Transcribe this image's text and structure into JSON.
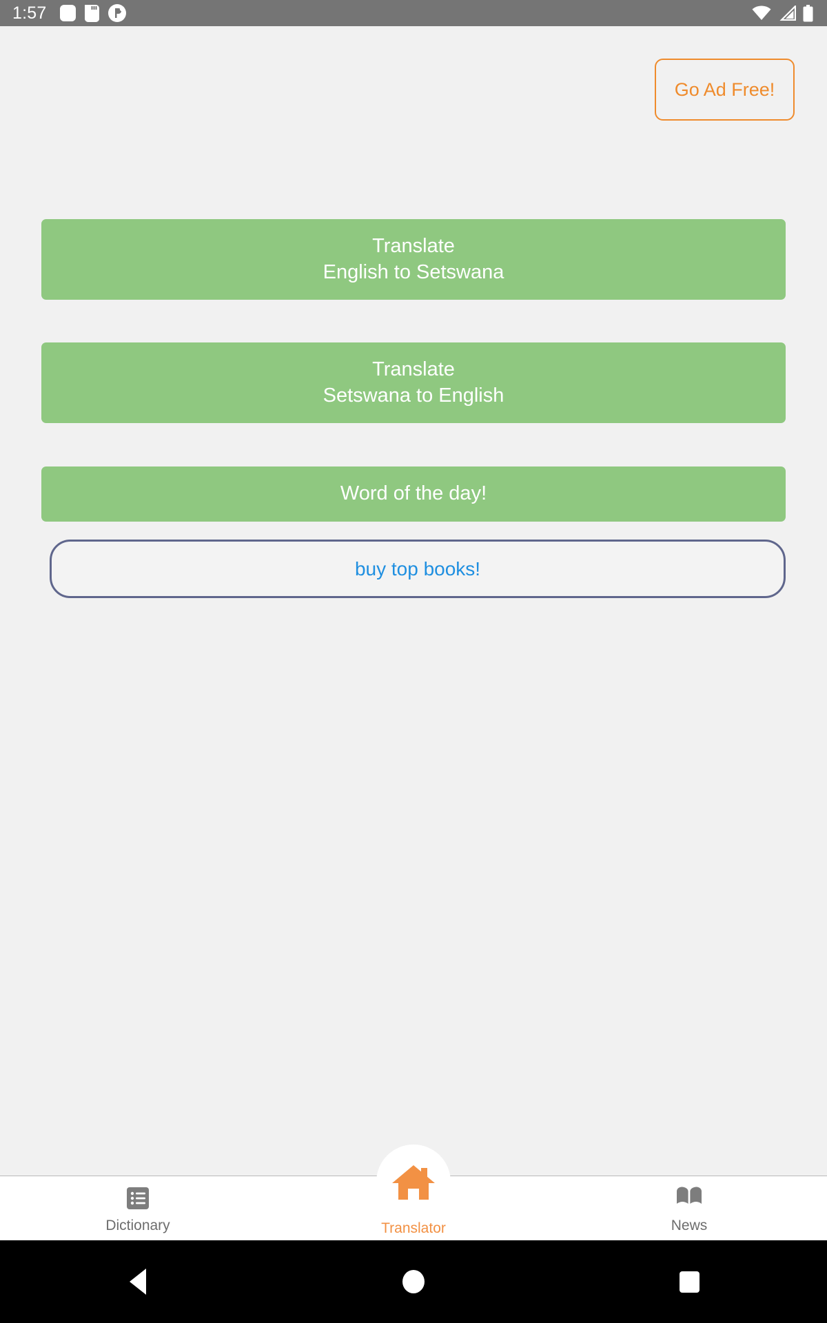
{
  "status_bar": {
    "time": "1:57",
    "background_color": "#757575",
    "left_icons": [
      "rounded-square-icon",
      "sd-card-icon",
      "app-circle-icon"
    ],
    "right_icons": [
      "wifi-icon",
      "cellular-signal-icon",
      "battery-icon"
    ]
  },
  "header": {
    "go_ad_free_label": "Go Ad Free!",
    "accent_color": "#ef8b2c"
  },
  "main": {
    "background_color": "#f1f1f1",
    "green_color": "#8fc880",
    "buttons": [
      {
        "line1": "Translate",
        "line2": "English to Setswana"
      },
      {
        "line1": "Translate",
        "line2": "Setswana to English"
      },
      {
        "line1": "Word of the day!",
        "line2": ""
      }
    ],
    "link_button": {
      "label": "buy top books!",
      "text_color": "#1f8fe0",
      "border_color": "#5f668c"
    }
  },
  "tab_bar": {
    "active_color": "#f29144",
    "inactive_color": "#6d6d6d",
    "tabs": [
      {
        "label": "Dictionary",
        "icon": "list-icon",
        "active": false
      },
      {
        "label": "Translator",
        "icon": "home-icon",
        "active": true
      },
      {
        "label": "News",
        "icon": "book-icon",
        "active": false
      }
    ]
  },
  "android_nav": {
    "buttons": [
      "back-button",
      "home-button",
      "recents-button"
    ]
  }
}
